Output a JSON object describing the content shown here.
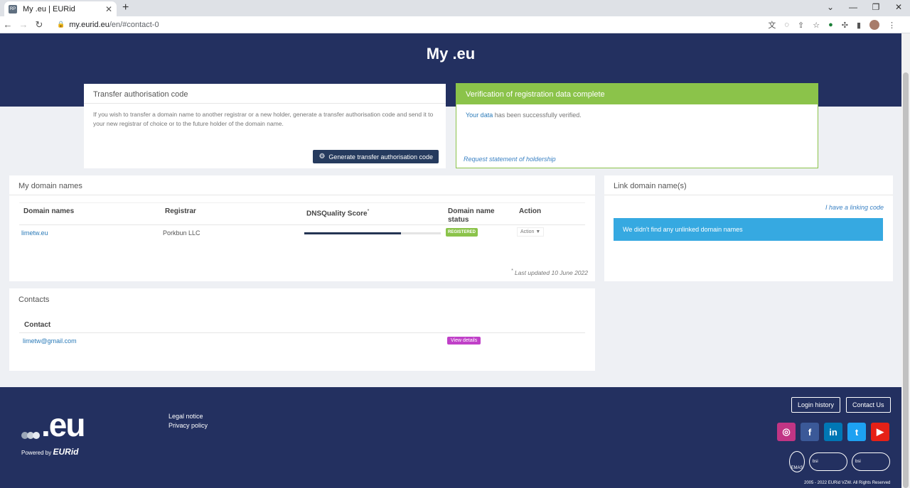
{
  "browser": {
    "tab_title": "My .eu | EURid",
    "favicon_text": "RP",
    "url_host": "my.eurid.eu",
    "url_path": "/en/#contact-0"
  },
  "page": {
    "title": "My .eu"
  },
  "transfer": {
    "heading": "Transfer authorisation code",
    "text": "If you wish to transfer a domain name to another registrar or a new holder, generate a transfer authorisation code and send it to your new registrar of choice or to the future holder of the domain name.",
    "button_label": "Generate transfer authorisation code"
  },
  "verification": {
    "heading": "Verification of registration data complete",
    "link_text": "Your data",
    "message": " has been successfully verified.",
    "request_link": "Request statement of holdership",
    "color": "#8bc34a"
  },
  "domains": {
    "heading": "My domain names",
    "columns": [
      "Domain names",
      "Registrar",
      "DNSQuality Score",
      "Domain name status",
      "Action"
    ],
    "score_marker": "*",
    "rows": [
      {
        "domain": "limetw.eu",
        "registrar": "Porkbun LLC",
        "dns_score_fraction": 0.71,
        "status": "REGISTERED",
        "action": "Action"
      }
    ],
    "footnote_marker": "*",
    "last_updated": "Last updated 10 June 2022"
  },
  "link_domains": {
    "heading": "Link domain name(s)",
    "link_text": "I have a linking code",
    "message": "We didn't find any unlinked domain names",
    "color": "#36a9e1"
  },
  "contacts": {
    "heading": "Contacts",
    "column": "Contact",
    "rows": [
      {
        "email": "limetw@gmail.com",
        "button": "View details"
      }
    ]
  },
  "footer": {
    "logo_text": ".eu",
    "powered_by": "Powered by",
    "brand": "EURid",
    "links": [
      "Legal notice",
      "Privacy policy"
    ],
    "login_history": "Login history",
    "contact_us": "Contact Us",
    "socials": [
      {
        "name": "instagram-icon",
        "glyph": "◎",
        "color": "#c13584"
      },
      {
        "name": "facebook-icon",
        "glyph": "f",
        "color": "#3b5998"
      },
      {
        "name": "linkedin-icon",
        "glyph": "in",
        "color": "#0077b5"
      },
      {
        "name": "twitter-icon",
        "glyph": "t",
        "color": "#1da1f2"
      },
      {
        "name": "youtube-icon",
        "glyph": "▶",
        "color": "#e62117"
      }
    ],
    "emas_label": "EMAS",
    "bsi_label": "bsi",
    "copyright": "2005 - 2022 EURid VZW. All Rights Reserved",
    "background": "#233060"
  }
}
